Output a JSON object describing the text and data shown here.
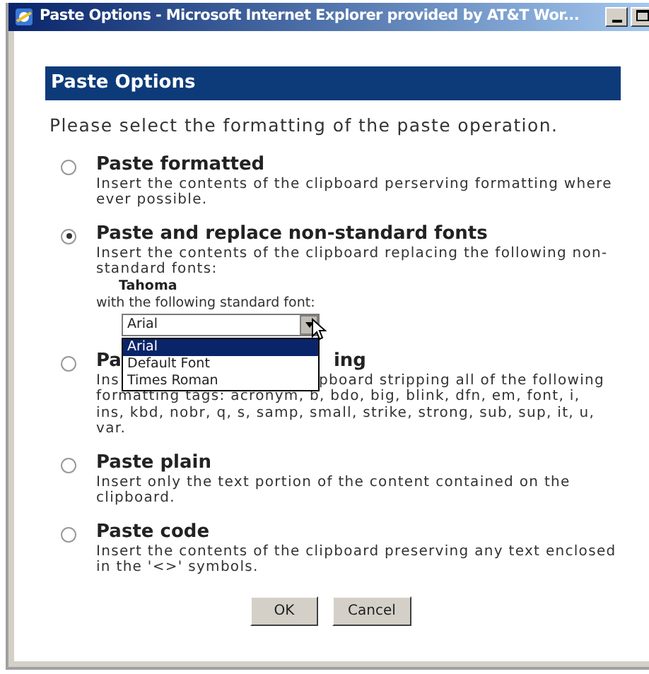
{
  "window": {
    "title": "Paste Options - Microsoft Internet Explorer provided by AT&T Wor..."
  },
  "header": "Paste Options",
  "intro": "Please select the formatting of the paste operation.",
  "options": [
    {
      "kind": "plain",
      "title": [
        "Paste formatted"
      ],
      "selected": false,
      "lines": [
        [
          "Insert the contents of the clipboard perserving formatting where"
        ],
        [
          "ever possible."
        ]
      ]
    },
    {
      "kind": "fonts",
      "title": [
        "Paste and replace non-standard fonts"
      ],
      "selected": true,
      "lines": [
        [
          "Insert the contents of the clipboard replacing the following non-"
        ],
        [
          "standard fonts:"
        ]
      ],
      "font_name": "Tahoma",
      "font_label": "with the following standard font:",
      "select": {
        "value": "Arial",
        "expanded": true,
        "items": [
          {
            "label": "Arial",
            "selected": true
          },
          {
            "label": "Default Font",
            "selected": false
          },
          {
            "label": "Times Roman",
            "selected": false
          }
        ]
      }
    },
    {
      "kind": "plain",
      "title": [
        "Pa",
        "ing"
      ],
      "selected": false,
      "lines": [
        [
          "Ins",
          "pboard stripping all of the following"
        ],
        [
          "formatting tags: acronym, b, bdo, big, blink, dfn, em, font, i,"
        ],
        [
          "ins, kbd, nobr, q, s, samp, small, strike, strong, sub, sup, it, u,"
        ],
        [
          "var."
        ]
      ]
    },
    {
      "kind": "plain",
      "title": [
        "Paste plain"
      ],
      "selected": false,
      "lines": [
        [
          "Insert only the text portion of the content contained on the"
        ],
        [
          "clipboard."
        ]
      ]
    },
    {
      "kind": "plain",
      "title": [
        "Paste code"
      ],
      "selected": false,
      "lines": [
        [
          "Insert the contents of the clipboard preserving any text enclosed"
        ],
        [
          "in the '<>' symbols."
        ]
      ]
    }
  ],
  "buttons": [
    "OK",
    "Cancel"
  ]
}
